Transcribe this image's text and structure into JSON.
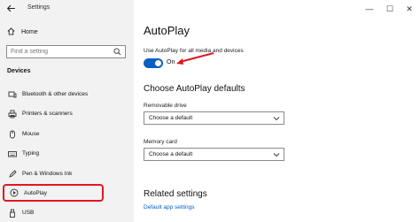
{
  "window": {
    "title": "Settings",
    "minimize": "—",
    "maximize": "☐",
    "close": "✕"
  },
  "sidebar": {
    "home": "Home",
    "search_placeholder": "Find a setting",
    "section": "Devices",
    "items": [
      {
        "label": "Bluetooth & other devices",
        "icon": "bluetooth-icon"
      },
      {
        "label": "Printers & scanners",
        "icon": "printer-icon"
      },
      {
        "label": "Mouse",
        "icon": "mouse-icon"
      },
      {
        "label": "Typing",
        "icon": "keyboard-icon"
      },
      {
        "label": "Pen & Windows Ink",
        "icon": "pen-icon"
      },
      {
        "label": "AutoPlay",
        "icon": "autoplay-icon",
        "selected": true
      },
      {
        "label": "USB",
        "icon": "usb-icon"
      }
    ]
  },
  "main": {
    "title": "AutoPlay",
    "toggle_caption": "Use AutoPlay for all media and devices",
    "toggle_state": "On",
    "defaults_heading": "Choose AutoPlay defaults",
    "removable_label": "Removable drive",
    "removable_value": "Choose a default",
    "memory_label": "Memory card",
    "memory_value": "Choose a default",
    "related_heading": "Related settings",
    "related_link": "Default app settings"
  },
  "colors": {
    "accent": "#0a5fc2",
    "highlight": "#e0181f",
    "sidebar_bg": "#f2f2f2"
  }
}
